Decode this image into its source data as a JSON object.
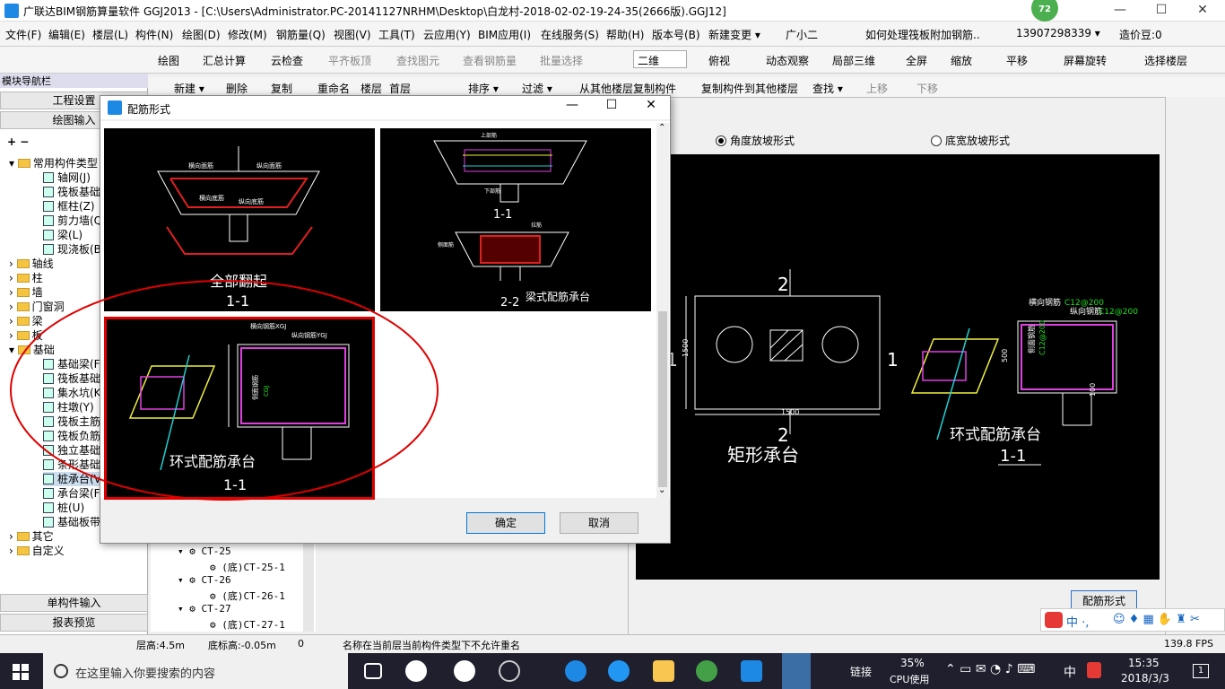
{
  "window": {
    "title": "广联达BIM钢筋算量软件 GGJ2013 - [C:\\Users\\Administrator.PC-20141127NRHM\\Desktop\\白龙村-2018-02-02-19-24-35(2666版).GGJ12]",
    "badge": "72",
    "minimize": "—",
    "maximize": "☐",
    "close": "✕"
  },
  "menu": [
    "文件(F)",
    "编辑(E)",
    "楼层(L)",
    "构件(N)",
    "绘图(D)",
    "修改(M)",
    "钢筋量(Q)",
    "视图(V)",
    "工具(T)",
    "云应用(Y)",
    "BIM应用(I)",
    "在线服务(S)",
    "帮助(H)",
    "版本号(B)",
    "新建变更 ▾",
    "广小二",
    "如何处理筏板附加钢筋..",
    "13907298339 ▾",
    "造价豆:0"
  ],
  "toolbar1": [
    "绘图",
    "汇总计算",
    "云检查",
    "平齐板顶",
    "查找图元",
    "查看钢筋量",
    "批量选择",
    "二维",
    "俯视",
    "动态观察",
    "局部三维",
    "全屏",
    "缩放",
    "平移",
    "屏幕旋转",
    "选择楼层"
  ],
  "toolbar2": [
    "新建 ▾",
    "删除",
    "复制",
    "重命名",
    "楼层",
    "首层",
    "排序 ▾",
    "过滤 ▾",
    "从其他楼层复制构件",
    "复制构件到其他楼层",
    "查找 ▾",
    "上移",
    "下移"
  ],
  "leftpanel": {
    "header": "模块导航栏",
    "buttons": [
      "工程设置",
      "绘图输入"
    ],
    "tree": [
      "常用构件类型",
      "轴网(J)",
      "筏板基础",
      "框柱(Z)",
      "剪力墙(Q)",
      "梁(L)",
      "现浇板(B)",
      "轴线",
      "柱",
      "墙",
      "门窗洞",
      "梁",
      "板",
      "基础",
      "基础梁(F)",
      "筏板基础",
      "集水坑(K)",
      "柱墩(Y)",
      "筏板主筋",
      "筏板负筋",
      "独立基础",
      "条形基础",
      "桩承台(V)",
      "承台梁(F)",
      "桩(U)",
      "基础板带",
      "其它",
      "自定义"
    ],
    "bottom": [
      "单构件输入",
      "报表预览"
    ]
  },
  "midlist": [
    "CT-25",
    "(底)CT-25-1",
    "CT-26",
    "(底)CT-26-1",
    "CT-27",
    "(底)CT-27-1"
  ],
  "right": {
    "radio1": "角度放坡形式",
    "radio2": "底宽放坡形式",
    "button": "配筋形式",
    "cad": {
      "rect_title": "矩形承台",
      "ring_title": "环式配筋承台",
      "sec": "1-1",
      "n2": "2",
      "n1": "1",
      "dim1500": "1500",
      "rebar1": "横向钢筋",
      "rebar1v": "C12@200",
      "rebar2": "纵向钢筋",
      "rebar2v": "C12@200",
      "side": "侧面钢筋",
      "sidev": "C12@200",
      "h500": "500",
      "h100": "100"
    }
  },
  "dialog": {
    "title": "配筋形式",
    "ok": "确定",
    "cancel": "取消",
    "thumbs": [
      {
        "name": "全部翻起",
        "sec": "1-1",
        "labels": [
          "横向面筋",
          "纵向面筋",
          "横向底筋",
          "纵向底筋"
        ]
      },
      {
        "name": "梁式配筋承台",
        "sec1": "1-1",
        "sec2": "2-2",
        "labels": [
          "上部筋",
          "侧面筋",
          "下部筋",
          "拉筋"
        ]
      },
      {
        "name": "环式配筋承台",
        "sec": "1-1",
        "labels": [
          "横向钢筋XGJ",
          "纵向钢筋YGJ",
          "侧面钢筋",
          "CGJ"
        ]
      }
    ]
  },
  "status": [
    "层高:4.5m",
    "底标高:-0.05m",
    "0",
    "名称在当前层当前构件类型下不允许重名",
    "139.8 FPS"
  ],
  "taskbar": {
    "search": "在这里输入你要搜索的内容",
    "tray": [
      "链接",
      "35%",
      "CPU使用",
      "中",
      "15:35",
      "2018/3/3",
      "1"
    ]
  },
  "colors": {
    "cad_bg": "#000000",
    "cad_white": "#ffffff",
    "cad_magenta": "#e040e0",
    "cad_yellow": "#f0f040",
    "cad_cyan": "#20d0d0",
    "cad_red": "#e02020",
    "cad_green": "#20e020",
    "annot_red": "#e00000"
  }
}
